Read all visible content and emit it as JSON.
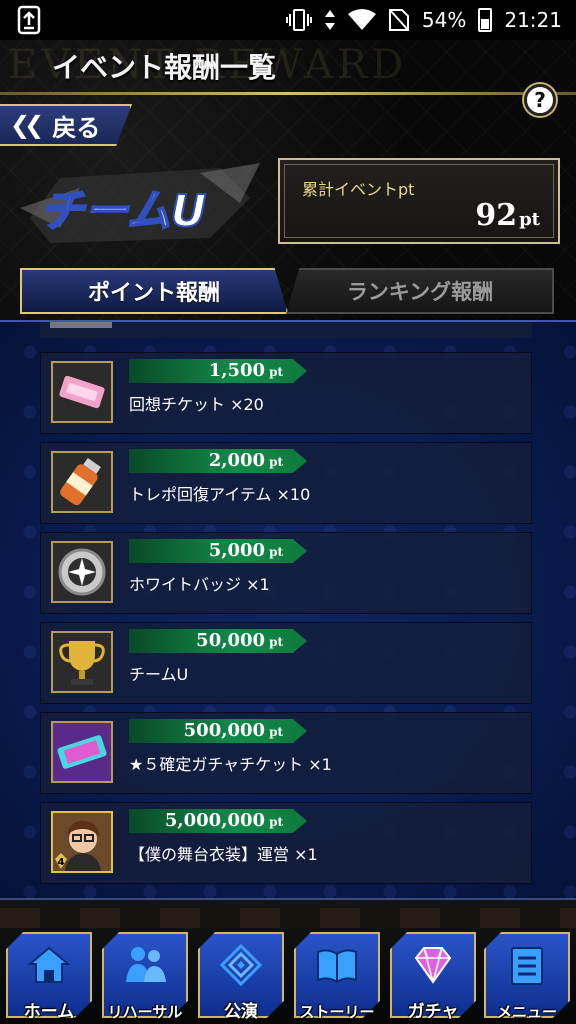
{
  "status_bar": {
    "battery": "54%",
    "time": "21:21"
  },
  "header": {
    "watermark": "EVENT REWARD",
    "title": "イベント報酬一覧",
    "help_label": "?",
    "back_label": "戻る",
    "team_name": "チームU",
    "total_label": "累計イベントpt",
    "total_value": "92",
    "total_unit": "pt"
  },
  "tabs": [
    {
      "label": "ポイント報酬",
      "active": true
    },
    {
      "label": "ランキング報酬",
      "active": false
    }
  ],
  "rewards": [
    {
      "points": "1,500",
      "unit": "pt",
      "name": "回想チケット ×20",
      "icon": "ticket-icon"
    },
    {
      "points": "2,000",
      "unit": "pt",
      "name": "トレポ回復アイテム ×10",
      "icon": "bottle-icon"
    },
    {
      "points": "5,000",
      "unit": "pt",
      "name": "ホワイトバッジ ×1",
      "icon": "badge-icon"
    },
    {
      "points": "50,000",
      "unit": "pt",
      "name": "チームU",
      "icon": "trophy-icon"
    },
    {
      "points": "500,000",
      "unit": "pt",
      "name": "★５確定ガチャチケット ×1",
      "icon": "gacha-ticket-icon"
    },
    {
      "points": "5,000,000",
      "unit": "pt",
      "name": "【僕の舞台衣装】運営 ×1",
      "icon": "character-card-icon",
      "badge": "4"
    }
  ],
  "nav": [
    {
      "label": "ホーム",
      "icon": "home-icon"
    },
    {
      "label": "リハーサル",
      "icon": "people-icon"
    },
    {
      "label": "公演",
      "icon": "stage-icon"
    },
    {
      "label": "ストーリー",
      "icon": "book-icon"
    },
    {
      "label": "ガチャ",
      "icon": "diamond-icon"
    },
    {
      "label": "メニュー",
      "icon": "notepad-icon"
    }
  ],
  "colors": {
    "accent_gold": "#d9c27a",
    "pt_green": "#138a4a",
    "nav_blue": "#2a54c8",
    "list_bg": "#081848"
  }
}
